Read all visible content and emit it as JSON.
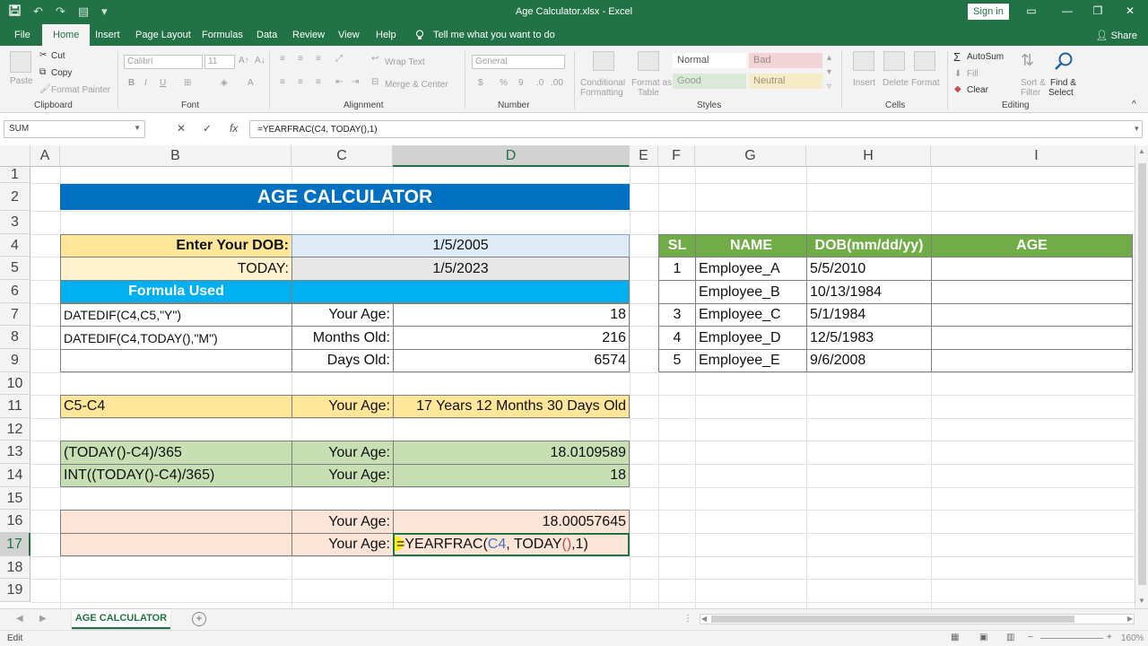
{
  "titlebar": {
    "title": "Age Calculator.xlsx  -  Excel",
    "sign_in": "Sign in",
    "qat_undo": "↶",
    "qat_redo": "↷",
    "qat_customize": "▾",
    "minimize": "—",
    "restore": "❐",
    "close": "✕",
    "ribbon_display": "▭"
  },
  "tabs": {
    "file": "File",
    "home": "Home",
    "insert": "Insert",
    "page_layout": "Page Layout",
    "formulas": "Formulas",
    "data": "Data",
    "review": "Review",
    "view": "View",
    "help": "Help",
    "tell_me": "Tell me what you want to do",
    "share": "Share"
  },
  "ribbon": {
    "clipboard": {
      "label": "Clipboard",
      "paste": "Paste",
      "cut": "Cut",
      "copy": "Copy",
      "format_painter": "Format Painter"
    },
    "font": {
      "label": "Font",
      "font_name": "Calibri",
      "font_size": "11"
    },
    "alignment": {
      "label": "Alignment",
      "wrap_text": "Wrap Text",
      "merge_center": "Merge & Center"
    },
    "number": {
      "label": "Number",
      "format": "General"
    },
    "styles": {
      "label": "Styles",
      "conditional": "Conditional",
      "formatting": "Formatting",
      "format_as": "Format as",
      "table": "Table",
      "normal": "Normal",
      "bad": "Bad",
      "good": "Good",
      "neutral": "Neutral"
    },
    "cells": {
      "label": "Cells",
      "insert": "Insert",
      "delete": "Delete",
      "format": "Format"
    },
    "editing": {
      "label": "Editing",
      "autosum": "AutoSum",
      "fill": "Fill",
      "clear": "Clear",
      "sort_filter": "Sort &",
      "filter": "Filter",
      "find_select": "Find &",
      "select": "Select"
    }
  },
  "formula_bar": {
    "name_box": "SUM",
    "formula": "=YEARFRAC(C4, TODAY(),1)"
  },
  "columns": [
    "A",
    "B",
    "C",
    "D",
    "E",
    "F",
    "G",
    "H",
    "I"
  ],
  "rows": [
    "1",
    "2",
    "3",
    "4",
    "5",
    "6",
    "7",
    "8",
    "9",
    "10",
    "11",
    "12",
    "13",
    "14",
    "15",
    "16",
    "17",
    "18",
    "19"
  ],
  "sheet": {
    "title": "AGE CALCULATOR",
    "dob_label": "Enter Your DOB:",
    "dob_value": "1/5/2005",
    "today_label": "TODAY:",
    "today_value": "1/5/2023",
    "formula_used": "Formula Used",
    "r7_formula": "DATEDIF(C4,C5,\"Y\")",
    "r7_label": "Your Age:",
    "r7_value": "18",
    "r8_formula": "DATEDIF(C4,TODAY(),\"M\")",
    "r8_label": "Months Old:",
    "r8_value": "216",
    "r9_label": "Days Old:",
    "r9_value": "6574",
    "r11_formula": "C5-C4",
    "r11_label": "Your Age:",
    "r11_value": "17 Years 12 Months 30 Days Old",
    "r13_formula": "(TODAY()-C4)/365",
    "r13_label": "Your Age:",
    "r13_value": "18.0109589",
    "r14_formula": "INT((TODAY()-C4)/365)",
    "r14_label": "Your Age:",
    "r14_value": "18",
    "r16_label": "Your Age:",
    "r16_value": "18.00057645",
    "r17_label": "Your Age:",
    "r17_edit": {
      "eq": "=",
      "fn": "YEARFRAC(",
      "ref": "C4",
      "mid": ", TODAY",
      "paren": "()",
      "end": ",1)"
    }
  },
  "employee_table": {
    "headers": [
      "SL",
      "NAME",
      "DOB(mm/dd/yy)",
      "AGE"
    ],
    "rows": [
      {
        "sl": "1",
        "name": "Employee_A",
        "dob": "5/5/2010",
        "age": ""
      },
      {
        "sl": "",
        "name": "Employee_B",
        "dob": "10/13/1984",
        "age": ""
      },
      {
        "sl": "3",
        "name": "Employee_C",
        "dob": "5/1/1984",
        "age": ""
      },
      {
        "sl": "4",
        "name": "Employee_D",
        "dob": "12/5/1983",
        "age": ""
      },
      {
        "sl": "5",
        "name": "Employee_E",
        "dob": "9/6/2008",
        "age": ""
      }
    ]
  },
  "sheet_tabs": {
    "active": "AGE CALCULATOR",
    "add": "+"
  },
  "status": {
    "mode": "Edit",
    "zoom": "160%"
  },
  "colors": {
    "excel_green": "#217346",
    "title_blue": "#0070c0",
    "cyan_header": "#00b0f0",
    "yellow": "#ffe699",
    "light_yellow": "#fff2cc",
    "light_blue": "#ddebf7",
    "green_light": "#c6e0b4",
    "peach": "#fce4d6",
    "table_green": "#70ad47"
  }
}
